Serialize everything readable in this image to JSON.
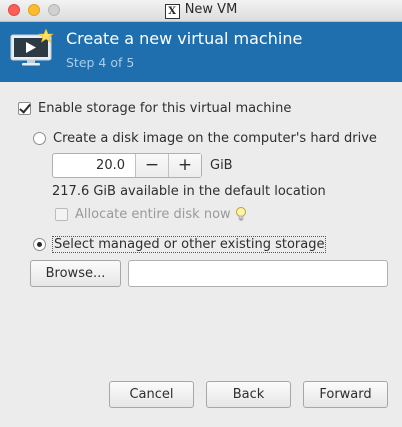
{
  "window": {
    "title": "New VM",
    "title_icon_glyph": "X"
  },
  "header": {
    "title": "Create a new virtual machine",
    "step": "Step 4 of 5",
    "color": "#1f6fae"
  },
  "storage": {
    "enable_label": "Enable storage for this virtual machine",
    "enable_checked": true,
    "create_disk_label": "Create a disk image on the computer's hard drive",
    "create_disk_selected": false,
    "disk_size": "20.0",
    "minus_label": "−",
    "plus_label": "+",
    "disk_unit": "GiB",
    "available_text": "217.6 GiB available in the default location",
    "allocate_label": "Allocate entire disk now",
    "allocate_checked": false,
    "existing_label": "Select managed or other existing storage",
    "existing_selected": true,
    "browse_label": "Browse...",
    "path_value": ""
  },
  "footer": {
    "cancel_label": "Cancel",
    "back_label": "Back",
    "forward_label": "Forward"
  }
}
